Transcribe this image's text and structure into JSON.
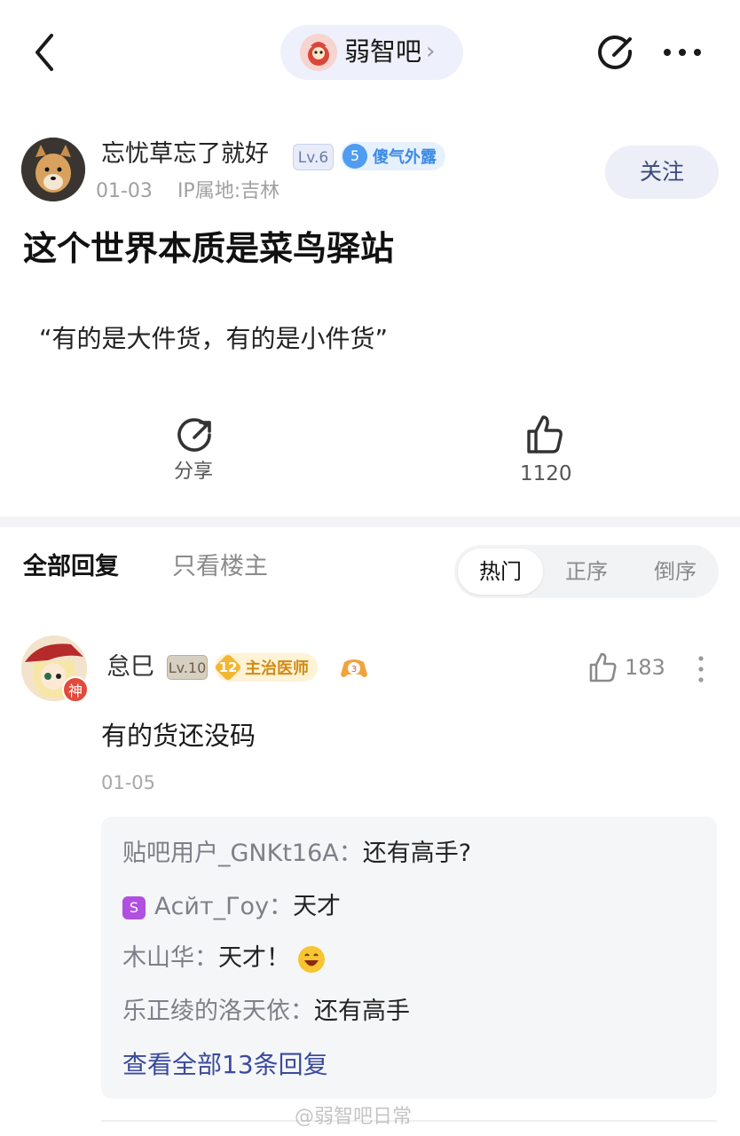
{
  "header": {
    "forum_name": "弱智吧",
    "chevron": "›",
    "back_icon": "back-icon",
    "edit_icon": "edit-icon",
    "more_icon": "more-icon"
  },
  "post": {
    "author": {
      "name": "忘忧草忘了就好",
      "level": "Lv.6",
      "badge_num": "5",
      "badge_text": "傻气外露",
      "date": "01-03",
      "ip": "IP属地:吉林"
    },
    "follow_label": "关注",
    "title": "这个世界本质是菜鸟驿站",
    "body": "“有的是大件货，有的是小件货”",
    "share_label": "分享",
    "like_count": "1120"
  },
  "tabs": {
    "all": "全部回复",
    "op_only": "只看楼主",
    "sort_hot": "热门",
    "sort_asc": "正序",
    "sort_desc": "倒序"
  },
  "comment": {
    "name": "怠巳",
    "level": "Lv.10",
    "badge_num": "12",
    "badge_text": "主治医师",
    "avatar_badge": "神",
    "like_count": "183",
    "text": "有的货还没码",
    "date": "01-05",
    "replies": [
      {
        "who": "贴吧用户_GNKt16A：",
        "text": "还有高手?"
      },
      {
        "who": "Асйт_Гоу：",
        "text": "天才",
        "vip": "S"
      },
      {
        "who": "木山华：",
        "text": "天才！"
      },
      {
        "who": "乐正绫的洛天依：",
        "text": "还有高手"
      }
    ],
    "view_all": "查看全部13条回复"
  },
  "watermark": "@弱智吧日常",
  "colors": {
    "accent_blue": "#3a4a9c",
    "follow_bg": "#eceef8",
    "badge_blue": "#4f9cf0",
    "badge_gold": "#f3b632"
  }
}
